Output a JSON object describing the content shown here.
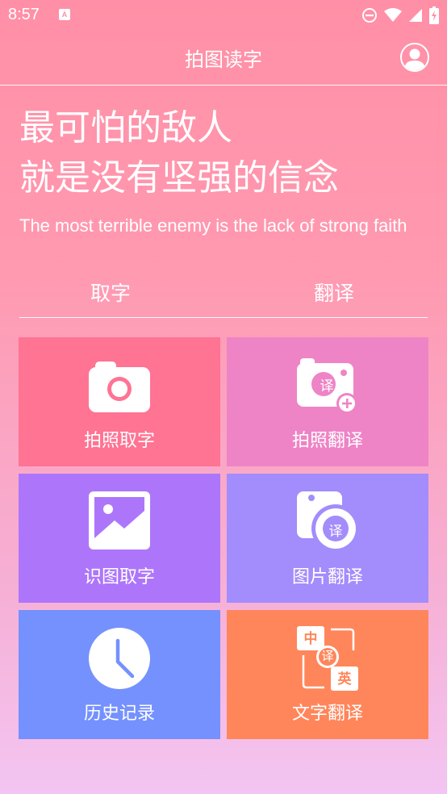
{
  "status_bar": {
    "time": "8:57",
    "notification_glyph": "A"
  },
  "app_bar": {
    "title": "拍图读字"
  },
  "quote": {
    "cn_line1": "最可怕的敌人",
    "cn_line2": "就是没有坚强的信念",
    "en": "The most terrible enemy is the lack of strong faith"
  },
  "tabs": [
    {
      "label": "取字"
    },
    {
      "label": "翻译"
    }
  ],
  "tiles": [
    {
      "label": "拍照取字",
      "icon": "camera-icon",
      "color": "#ff7393"
    },
    {
      "label": "拍照翻译",
      "icon": "camera-translate-add-icon",
      "color": "#ee84c6"
    },
    {
      "label": "识图取字",
      "icon": "image-icon",
      "color": "#ad76fa"
    },
    {
      "label": "图片翻译",
      "icon": "image-translate-icon",
      "color": "#a38cfb"
    },
    {
      "label": "历史记录",
      "icon": "clock-icon",
      "color": "#7491fd"
    },
    {
      "label": "文字翻译",
      "icon": "text-translate-icon",
      "color": "#ff865b"
    }
  ],
  "icon_glyphs": {
    "translate": "译",
    "chinese": "中",
    "english": "英"
  }
}
